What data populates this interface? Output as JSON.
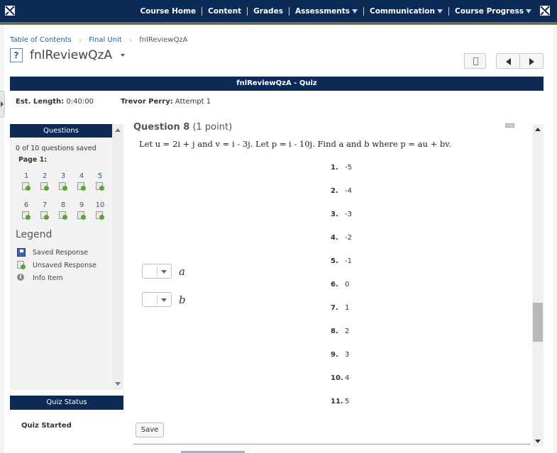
{
  "nav": {
    "items": [
      {
        "label": "Course Home",
        "dropdown": false
      },
      {
        "label": "Content",
        "dropdown": false
      },
      {
        "label": "Grades",
        "dropdown": false
      },
      {
        "label": "Assessments",
        "dropdown": true
      },
      {
        "label": "Communication",
        "dropdown": true
      },
      {
        "label": "Course Progress",
        "dropdown": true
      }
    ]
  },
  "breadcrumb": [
    "Table of Contents",
    "Final Unit",
    "fnlReviewQzA"
  ],
  "page": {
    "title": "fnlReviewQzA",
    "help_icon": "?"
  },
  "banner": "fnlReviewQzA - Quiz",
  "meta": {
    "length_label": "Est. Length:",
    "length_value": "0:40:00",
    "user_label": "Trevor Perry:",
    "user_value": "Attempt 1"
  },
  "questions_panel": {
    "header": "Questions",
    "saved_text": "0 of 10 questions saved",
    "page_label": "Page 1:",
    "numbers": [
      "1",
      "2",
      "3",
      "4",
      "5",
      "6",
      "7",
      "8",
      "9",
      "10"
    ],
    "legend_title": "Legend",
    "legend": [
      {
        "label": "Saved Response",
        "icon": "saved-response-icon"
      },
      {
        "label": "Unsaved Response",
        "icon": "unsaved-response-icon"
      },
      {
        "label": "Info Item",
        "icon": "info-icon"
      }
    ]
  },
  "quiz_status": {
    "header": "Quiz Status",
    "value": "Quiz Started"
  },
  "question": {
    "label": "Question 8",
    "points": "(1 point)",
    "text": "Let u = 2i + j and v = i - 3j. Let p = i - 10j. Find a and b where p = au + bv.",
    "choices": [
      {
        "num": "1.",
        "value": "-5"
      },
      {
        "num": "2.",
        "value": "-4"
      },
      {
        "num": "3.",
        "value": "-3"
      },
      {
        "num": "4.",
        "value": "-2"
      },
      {
        "num": "5.",
        "value": "-1"
      },
      {
        "num": "6.",
        "value": "0"
      },
      {
        "num": "7.",
        "value": "1"
      },
      {
        "num": "8.",
        "value": "2"
      },
      {
        "num": "9.",
        "value": "3"
      },
      {
        "num": "10.",
        "value": "4"
      },
      {
        "num": "11.",
        "value": "5"
      }
    ],
    "answers": [
      {
        "var": "a",
        "selected": ""
      },
      {
        "var": "b",
        "selected": ""
      }
    ],
    "save_label": "Save"
  }
}
